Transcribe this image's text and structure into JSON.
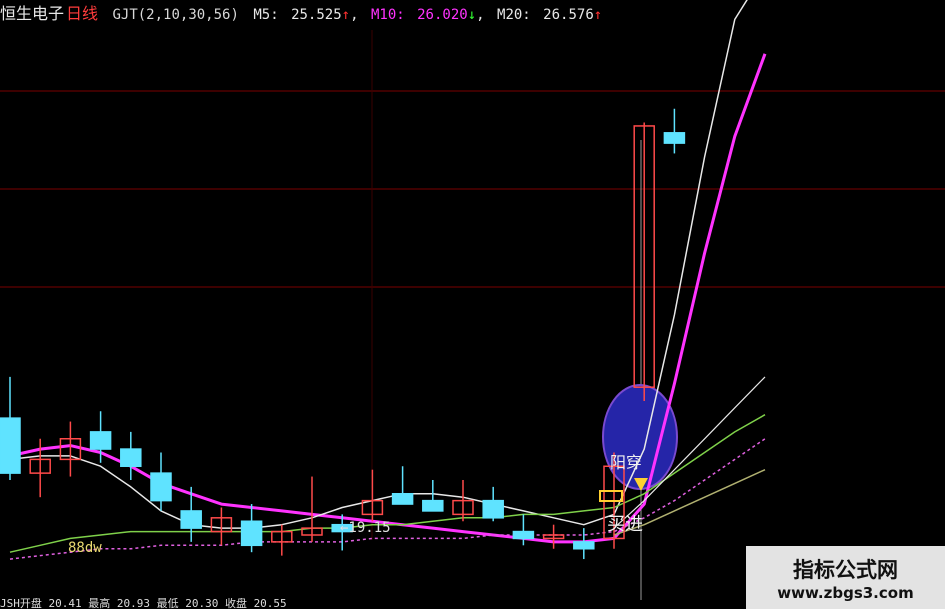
{
  "header": {
    "stock_name": "恒生电子",
    "period": "日线",
    "indicator": "GJT(2,10,30,56)",
    "ma5_label": "M5:",
    "ma5_value": "25.525",
    "ma5_arrow": "↑",
    "ma10_label": "M10:",
    "ma10_value": "26.020",
    "ma10_arrow": "↓",
    "ma20_label": "M20:",
    "ma20_value": "26.576",
    "ma20_arrow": "↑",
    "separator": ","
  },
  "colors": {
    "background": "#000000",
    "up_candle": "#ff4a4a",
    "down_candle": "#5fe3ff",
    "ma_magenta": "#ff33ff",
    "ma_white": "#e8e8e8",
    "ma_green": "#7fd14a",
    "ma_olive": "#b0b070",
    "ma_pinkdash": "#e060e0",
    "buy_marker": "#2525a8",
    "text_yellow": "#e8d870",
    "grid_red": "#7a0000"
  },
  "chart_data": {
    "type": "candlestick",
    "ylim": [
      18,
      34
    ],
    "annotations": {
      "low_label": "←19.15",
      "bottom_left_label": "88dw",
      "yang_label": "阳穿",
      "buy_label": "买进"
    },
    "candles": [
      {
        "o": 23.0,
        "h": 24.2,
        "l": 21.2,
        "c": 21.4
      },
      {
        "o": 21.4,
        "h": 22.4,
        "l": 20.7,
        "c": 21.8
      },
      {
        "o": 21.8,
        "h": 22.9,
        "l": 21.3,
        "c": 22.4
      },
      {
        "o": 22.6,
        "h": 23.2,
        "l": 21.7,
        "c": 22.1
      },
      {
        "o": 22.1,
        "h": 22.6,
        "l": 21.2,
        "c": 21.6
      },
      {
        "o": 21.4,
        "h": 22.0,
        "l": 20.3,
        "c": 20.6
      },
      {
        "o": 20.3,
        "h": 21.0,
        "l": 19.4,
        "c": 19.8
      },
      {
        "o": 19.7,
        "h": 20.4,
        "l": 19.3,
        "c": 20.1
      },
      {
        "o": 20.0,
        "h": 20.5,
        "l": 19.1,
        "c": 19.3
      },
      {
        "o": 19.4,
        "h": 19.9,
        "l": 19.0,
        "c": 19.7
      },
      {
        "o": 19.6,
        "h": 21.3,
        "l": 19.4,
        "c": 19.8
      },
      {
        "o": 19.9,
        "h": 20.2,
        "l": 19.15,
        "c": 19.7
      },
      {
        "o": 20.2,
        "h": 21.5,
        "l": 20.0,
        "c": 20.6
      },
      {
        "o": 20.8,
        "h": 21.6,
        "l": 20.5,
        "c": 20.5
      },
      {
        "o": 20.6,
        "h": 21.2,
        "l": 20.3,
        "c": 20.3
      },
      {
        "o": 20.2,
        "h": 21.2,
        "l": 20.0,
        "c": 20.6
      },
      {
        "o": 20.6,
        "h": 21.0,
        "l": 20.0,
        "c": 20.1
      },
      {
        "o": 19.7,
        "h": 20.2,
        "l": 19.3,
        "c": 19.5
      },
      {
        "o": 19.5,
        "h": 19.9,
        "l": 19.2,
        "c": 19.6
      },
      {
        "o": 19.4,
        "h": 19.8,
        "l": 18.9,
        "c": 19.2
      },
      {
        "o": 19.5,
        "h": 22.0,
        "l": 19.2,
        "c": 21.6
      },
      {
        "o": 23.9,
        "h": 31.6,
        "l": 23.5,
        "c": 31.5
      },
      {
        "o": 31.3,
        "h": 32.0,
        "l": 30.7,
        "c": 31.0
      }
    ],
    "series": [
      {
        "color": "ma_magenta",
        "width": 3,
        "dash": "",
        "values": [
          21.9,
          22.1,
          22.2,
          22.0,
          21.6,
          21.1,
          20.8,
          20.5,
          20.4,
          20.3,
          20.2,
          20.1,
          20.0,
          19.9,
          19.8,
          19.7,
          19.6,
          19.5,
          19.4,
          19.4,
          19.5,
          20.5,
          24.0,
          27.8,
          31.2,
          33.6
        ]
      },
      {
        "color": "ma_white",
        "width": 1.5,
        "dash": "",
        "values": [
          21.8,
          21.9,
          21.9,
          21.6,
          21.0,
          20.3,
          19.9,
          19.8,
          19.8,
          19.9,
          20.1,
          20.4,
          20.6,
          20.8,
          20.8,
          20.7,
          20.5,
          20.3,
          20.1,
          19.9,
          20.2,
          22.1,
          26.0,
          30.6,
          34.6,
          36.0
        ]
      },
      {
        "color": "ma_green",
        "width": 1.5,
        "dash": "",
        "values": [
          19.1,
          19.3,
          19.5,
          19.6,
          19.7,
          19.7,
          19.7,
          19.7,
          19.7,
          19.7,
          19.8,
          19.8,
          19.9,
          19.9,
          20.0,
          20.1,
          20.1,
          20.2,
          20.2,
          20.3,
          20.4,
          20.8,
          21.4,
          22.0,
          22.6,
          23.1
        ]
      },
      {
        "color": "ma_pinkdash",
        "width": 1.5,
        "dash": "3,3",
        "values": [
          18.9,
          19.0,
          19.1,
          19.2,
          19.2,
          19.3,
          19.3,
          19.3,
          19.4,
          19.4,
          19.4,
          19.4,
          19.5,
          19.5,
          19.5,
          19.5,
          19.6,
          19.6,
          19.6,
          19.6,
          19.7,
          20.1,
          20.6,
          21.2,
          21.8,
          22.4
        ]
      },
      {
        "color": "ma_olive",
        "width": 1.5,
        "dash": "",
        "values": [
          null,
          null,
          null,
          null,
          null,
          null,
          null,
          null,
          null,
          null,
          null,
          null,
          null,
          null,
          null,
          null,
          null,
          null,
          null,
          null,
          19.6,
          19.9,
          20.3,
          20.7,
          21.1,
          21.5
        ]
      },
      {
        "color": "ma_white",
        "width": 1.2,
        "dash": "",
        "values": [
          null,
          null,
          null,
          null,
          null,
          null,
          null,
          null,
          null,
          null,
          null,
          null,
          null,
          null,
          null,
          null,
          null,
          null,
          null,
          null,
          19.8,
          20.6,
          21.5,
          22.4,
          23.3,
          24.2
        ]
      }
    ]
  },
  "bottom_strip": "JSH开盘 20.41  最高 20.93 最低 20.30 收盘 20.55",
  "watermark": {
    "title": "指标公式网",
    "url": "www.zbgs3.com"
  }
}
